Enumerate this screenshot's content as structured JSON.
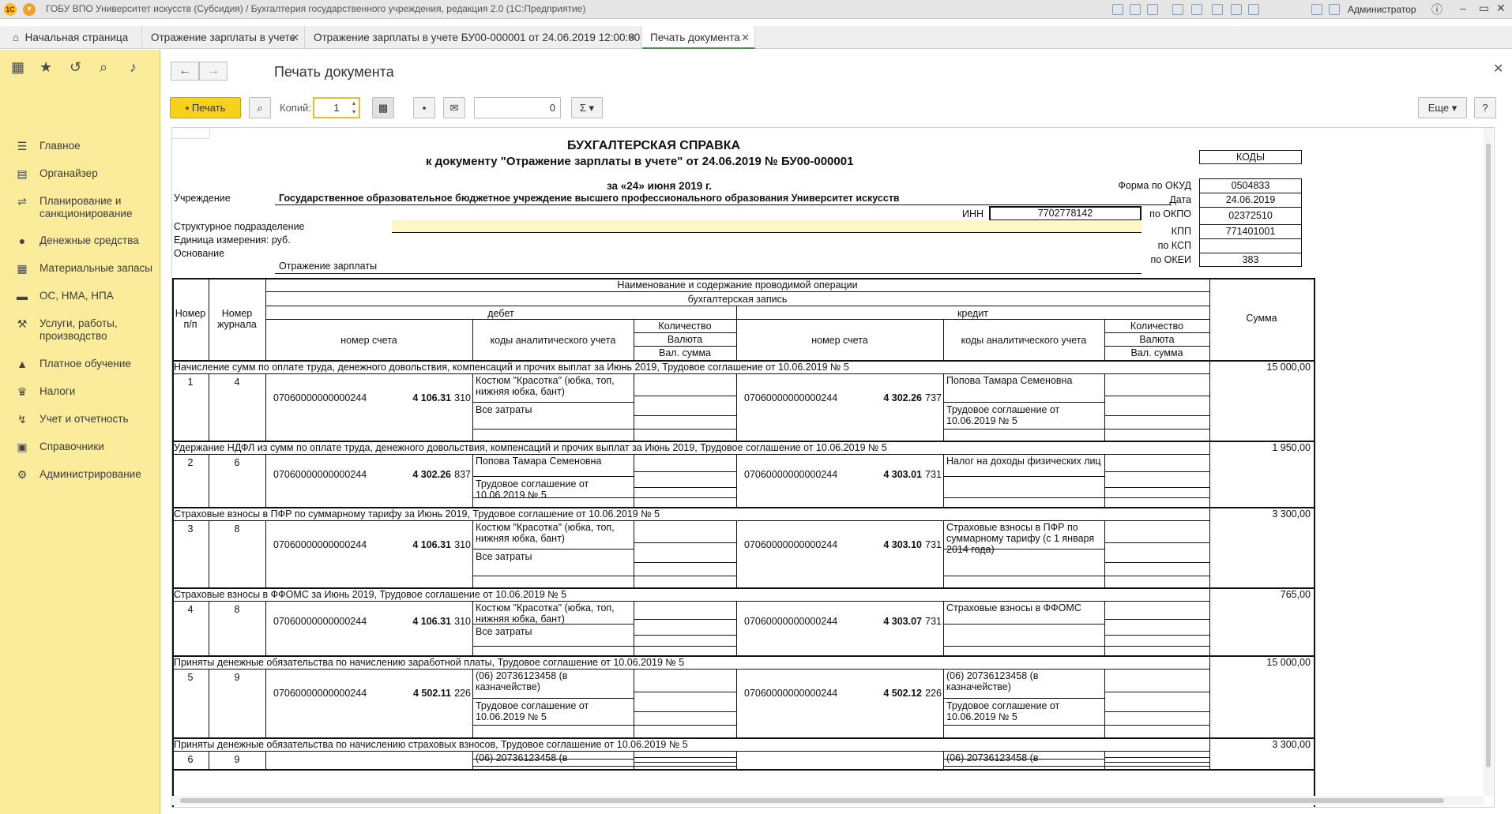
{
  "window": {
    "title": "ГОБУ ВПО Университет искусств (Субсидия) / Бухгалтерия государственного учреждения, редакция 2.0  (1С:Предприятие)",
    "user": "Администратор",
    "app_logo": "1С"
  },
  "tabs": [
    {
      "label": "Начальная страница",
      "icon": "home-icon"
    },
    {
      "label": "Отражение зарплаты в учете"
    },
    {
      "label": "Отражение зарплаты в учете БУ00-000001 от 24.06.2019 12:00:00"
    },
    {
      "label": "Печать документа"
    }
  ],
  "sidebar": {
    "items": [
      {
        "label": "Главное",
        "icon": "menu-icon"
      },
      {
        "label": "Органайзер",
        "icon": "organizer-icon"
      },
      {
        "label": "Планирование и",
        "label2": "санкционирование",
        "icon": "planning-icon"
      },
      {
        "label": "Денежные средства",
        "icon": "money-icon"
      },
      {
        "label": "Материальные запасы",
        "icon": "stock-icon"
      },
      {
        "label": "ОС, НМА, НПА",
        "icon": "truck-icon"
      },
      {
        "label": "Услуги, работы,",
        "label2": "производство",
        "icon": "services-icon"
      },
      {
        "label": "Платное обучение",
        "icon": "education-icon"
      },
      {
        "label": "Налоги",
        "icon": "taxes-icon"
      },
      {
        "label": "Учет и отчетность",
        "icon": "reports-icon"
      },
      {
        "label": "Справочники",
        "icon": "catalog-icon"
      },
      {
        "label": "Администрирование",
        "icon": "gear-icon"
      }
    ]
  },
  "form": {
    "title": "Печать документа",
    "print_label": "Печать",
    "copies_label": "Копий:",
    "copies_value": "1",
    "page_value": "0",
    "more_label": "Еще",
    "help_label": "?"
  },
  "doc": {
    "title": "БУХГАЛТЕРСКАЯ СПРАВКА",
    "subtitle": "к документу \"Отражение зарплаты в учете\" от 24.06.2019 № БУ00-000001",
    "date_line": "за «24» июня 2019 г.",
    "institution_label": "Учреждение",
    "institution": "Государственное образовательное бюджетное учреждение высшего профессионального образования Университет искусств",
    "inn_label": "ИНН",
    "inn": "7702778142",
    "division_label": "Структурное подразделение",
    "unit_label": "Единица измерения: руб.",
    "basis_label": "Основание",
    "basis": "Отражение зарплаты",
    "codes_header": "КОДЫ",
    "codes": [
      {
        "label": "Форма  по ОКУД",
        "value": "0504833"
      },
      {
        "label": "Дата",
        "value": "24.06.2019"
      },
      {
        "label": "по ОКПО",
        "value": "02372510"
      },
      {
        "label": "КПП",
        "value": "771401001"
      },
      {
        "label": "по КСП",
        "value": ""
      },
      {
        "label": "по ОКЕИ",
        "value": "383"
      }
    ],
    "table_head": {
      "col_num": "Номер п/п",
      "col_journal": "Номер журнала",
      "op_name": "Наименование и содержание проводимой операции",
      "entry": "бухгалтерская запись",
      "debit": "дебет",
      "credit": "кредит",
      "account_no": "номер счета",
      "analytic": "коды аналитического учета",
      "qty": "Количество",
      "currency": "Валюта",
      "cur_sum": "Вал. сумма",
      "sum": "Сумма"
    },
    "operations": [
      {
        "desc": "Начисление сумм по оплате труда, денежного довольствия, компенсаций и прочих выплат за Июнь 2019, Трудовое соглашение от 10.06.2019 № 5",
        "sum": "15 000,00",
        "num": "1",
        "journal": "4",
        "d_acc": "07060000000000244",
        "d_code": "4 106.31",
        "d_kosgu": "310",
        "d_an1": "Костюм \"Красотка\" (юбка, топ, нижняя юбка, бант)",
        "d_an2": "Все затраты",
        "c_acc": "07060000000000244",
        "c_code": "4 302.26",
        "c_kosgu": "737",
        "c_an1": "Попова Тамара Семеновна",
        "c_an2": "Трудовое соглашение от 10.06.2019 № 5"
      },
      {
        "desc": "Удержание НДФЛ из сумм по оплате труда, денежного довольствия, компенсаций и прочих выплат за Июнь 2019, Трудовое соглашение от 10.06.2019 № 5",
        "sum": "1 950,00",
        "num": "2",
        "journal": "6",
        "d_acc": "07060000000000244",
        "d_code": "4 302.26",
        "d_kosgu": "837",
        "d_an1": "Попова Тамара Семеновна",
        "d_an2": "Трудовое соглашение от 10.06.2019 № 5",
        "c_acc": "07060000000000244",
        "c_code": "4 303.01",
        "c_kosgu": "731",
        "c_an1": "Налог на доходы физических лиц",
        "c_an2": ""
      },
      {
        "desc": "Страховые взносы в ПФР по суммарному тарифу за Июнь 2019, Трудовое соглашение от 10.06.2019 № 5",
        "sum": "3 300,00",
        "num": "3",
        "journal": "8",
        "d_acc": "07060000000000244",
        "d_code": "4 106.31",
        "d_kosgu": "310",
        "d_an1": "Костюм \"Красотка\" (юбка, топ, нижняя юбка, бант)",
        "d_an2": "Все затраты",
        "c_acc": "07060000000000244",
        "c_code": "4 303.10",
        "c_kosgu": "731",
        "c_an1": "Страховые взносы в ПФР по суммарному тарифу (с 1 января 2014 года)",
        "c_an2": ""
      },
      {
        "desc": "Страховые взносы в ФФОМС за Июнь 2019, Трудовое соглашение от 10.06.2019 № 5",
        "sum": "765,00",
        "num": "4",
        "journal": "8",
        "d_acc": "07060000000000244",
        "d_code": "4 106.31",
        "d_kosgu": "310",
        "d_an1": "Костюм \"Красотка\" (юбка, топ, нижняя юбка, бант)",
        "d_an2": "Все затраты",
        "c_acc": "07060000000000244",
        "c_code": "4 303.07",
        "c_kosgu": "731",
        "c_an1": "Страховые взносы в ФФОМС",
        "c_an2": ""
      },
      {
        "desc": "Приняты денежные обязательства по начислению заработной платы, Трудовое соглашение от 10.06.2019 № 5",
        "sum": "15 000,00",
        "num": "5",
        "journal": "9",
        "d_acc": "07060000000000244",
        "d_code": "4 502.11",
        "d_kosgu": "226",
        "d_an1": "(06) 20736123458 (в казначействе)",
        "d_an2": "Трудовое соглашение от 10.06.2019 № 5",
        "c_acc": "07060000000000244",
        "c_code": "4 502.12",
        "c_kosgu": "226",
        "c_an1": "(06) 20736123458 (в казначействе)",
        "c_an2": "Трудовое соглашение от 10.06.2019 № 5"
      },
      {
        "desc": "Приняты денежные обязательства по начислению страховых взносов, Трудовое соглашение от 10.06.2019 № 5",
        "sum": "3 300,00",
        "num": "6",
        "journal": "9",
        "d_acc": "",
        "d_code": "",
        "d_kosgu": "",
        "d_an1": "(06) 20736123458 (в",
        "d_an2": "",
        "c_acc": "",
        "c_code": "",
        "c_kosgu": "",
        "c_an1": "(06) 20736123458 (в",
        "c_an2": ""
      }
    ]
  }
}
